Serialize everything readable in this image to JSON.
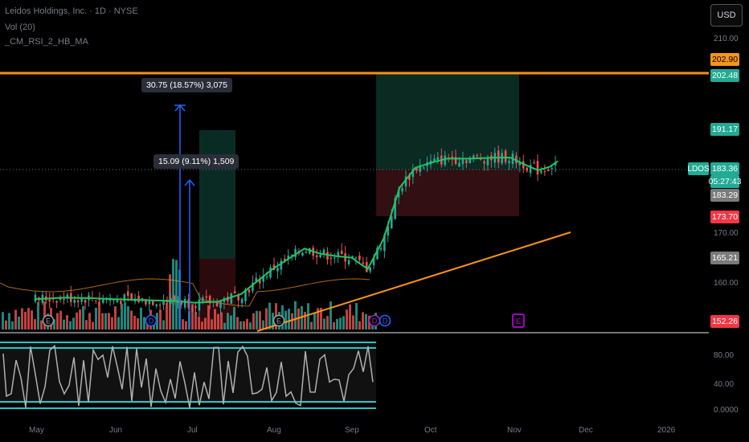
{
  "header": {
    "line1": "Leidos Holdings, Inc. · 1D · NYSE",
    "line2": "Vol (20)",
    "line3": "_CM_RSI_2_HB_MA"
  },
  "currency": "USD",
  "ticker": "LDOS",
  "price_badges": [
    {
      "value": "202.90",
      "bg": "#f7931a",
      "fg": "#000000"
    },
    {
      "value": "202.48",
      "bg": "#22ab94",
      "fg": "#ffffff"
    },
    {
      "value": "191.17",
      "bg": "#22ab94",
      "fg": "#ffffff"
    },
    {
      "value": "183.36",
      "bg": "#22ab94",
      "fg": "#ffffff"
    },
    {
      "value": "05:27:43",
      "bg": "#22ab94",
      "fg": "#ffffff"
    },
    {
      "value": "183.29",
      "bg": "#7a7a7a",
      "fg": "#ffffff"
    },
    {
      "value": "173.70",
      "bg": "#f23645",
      "fg": "#ffffff"
    },
    {
      "value": "165.21",
      "bg": "#7a7a7a",
      "fg": "#ffffff"
    },
    {
      "value": "152.26",
      "bg": "#f23645",
      "fg": "#ffffff"
    }
  ],
  "y_ticks": [
    "210.00",
    "170.00",
    "160.00"
  ],
  "rsi_ticks": [
    "80.00",
    "40.00",
    "0.0000"
  ],
  "x_labels": [
    "May",
    "Jun",
    "Jul",
    "Aug",
    "Sep",
    "Oct",
    "Nov",
    "Dec",
    "2026"
  ],
  "measure_labels": [
    "30.75 (18.57%) 3,075",
    "15.09 (9.11%) 1,509"
  ],
  "colors": {
    "up": "#26a69a",
    "down": "#ef5350",
    "ma": "#22c55e",
    "orange": "#f7931a",
    "rsi_band": "#2bc4c4"
  },
  "chart_data": {
    "type": "candlestick",
    "x": [
      "May",
      "Jun",
      "Jul",
      "Aug",
      "Sep",
      "Oct",
      "Nov",
      "Dec",
      "2026"
    ],
    "yrange": [
      150,
      212
    ],
    "close_path": [
      [
        0,
        156
      ],
      [
        0.35,
        156.3
      ],
      [
        0.7,
        156.2
      ],
      [
        1.0,
        156
      ],
      [
        1.4,
        155.8
      ],
      [
        1.8,
        155.6
      ],
      [
        2.0,
        155.3
      ],
      [
        2.3,
        155.5
      ],
      [
        2.6,
        157
      ],
      [
        3.0,
        162
      ],
      [
        3.2,
        164
      ],
      [
        3.4,
        166
      ],
      [
        3.6,
        165
      ],
      [
        3.8,
        164.5
      ],
      [
        4.0,
        164.2
      ],
      [
        4.1,
        163
      ],
      [
        4.2,
        162
      ],
      [
        4.4,
        168
      ],
      [
        4.6,
        178
      ],
      [
        4.8,
        182
      ],
      [
        5.0,
        183
      ],
      [
        5.2,
        183.8
      ],
      [
        5.5,
        183.8
      ],
      [
        5.8,
        184
      ],
      [
        6.0,
        184
      ],
      [
        6.2,
        182.5
      ],
      [
        6.35,
        181.5
      ],
      [
        6.5,
        182.2
      ],
      [
        6.6,
        183.3
      ]
    ],
    "levels": [
      202.9,
      202.48,
      191.17,
      183.36,
      183.29,
      173.7,
      165.21,
      152.26
    ],
    "measures": [
      {
        "change": 30.75,
        "pct": 18.57,
        "ticks": 3075
      },
      {
        "change": 15.09,
        "pct": 9.11,
        "ticks": 1509
      }
    ]
  }
}
